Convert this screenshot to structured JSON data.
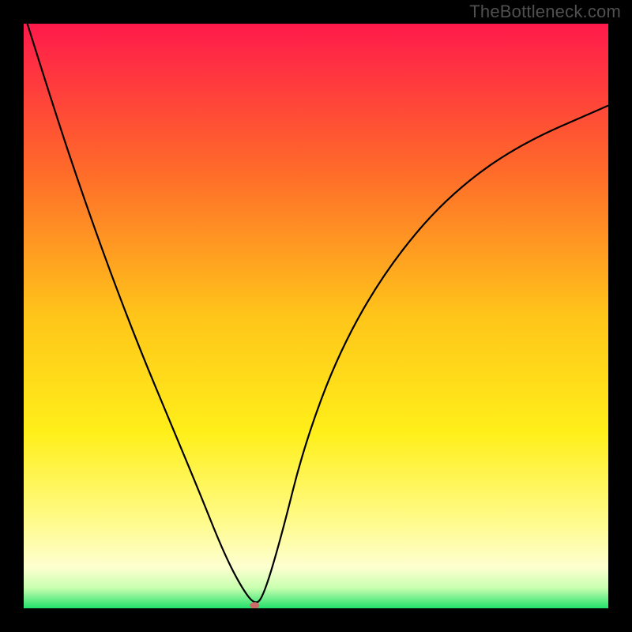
{
  "watermark": "TheBottleneck.com",
  "chart_data": {
    "type": "line",
    "title": "",
    "xlabel": "",
    "ylabel": "",
    "xlim": [
      0,
      100
    ],
    "ylim": [
      0,
      100
    ],
    "background_gradient": {
      "stops": [
        {
          "pos": 0.0,
          "color": "#ff1a4b"
        },
        {
          "pos": 0.25,
          "color": "#ff6a2a"
        },
        {
          "pos": 0.5,
          "color": "#ffc51a"
        },
        {
          "pos": 0.7,
          "color": "#ffef1a"
        },
        {
          "pos": 0.85,
          "color": "#fffb8a"
        },
        {
          "pos": 0.93,
          "color": "#fdffd0"
        },
        {
          "pos": 0.965,
          "color": "#c9ffb0"
        },
        {
          "pos": 1.0,
          "color": "#22e06a"
        }
      ]
    },
    "series": [
      {
        "name": "bottleneck-curve",
        "type": "curve",
        "x": [
          0,
          5,
          10,
          15,
          20,
          25,
          30,
          34,
          37,
          39.5,
          41,
          44,
          48,
          54,
          62,
          72,
          84,
          100
        ],
        "y": [
          102,
          86,
          71,
          57,
          44,
          32,
          20,
          10,
          4,
          0.5,
          2,
          12,
          28,
          44,
          58,
          70,
          79,
          86
        ]
      }
    ],
    "marker": {
      "name": "optimal-point",
      "x": 39.5,
      "y": 0.5,
      "color": "#cf6a6a",
      "rx": 6,
      "ry": 4
    }
  }
}
